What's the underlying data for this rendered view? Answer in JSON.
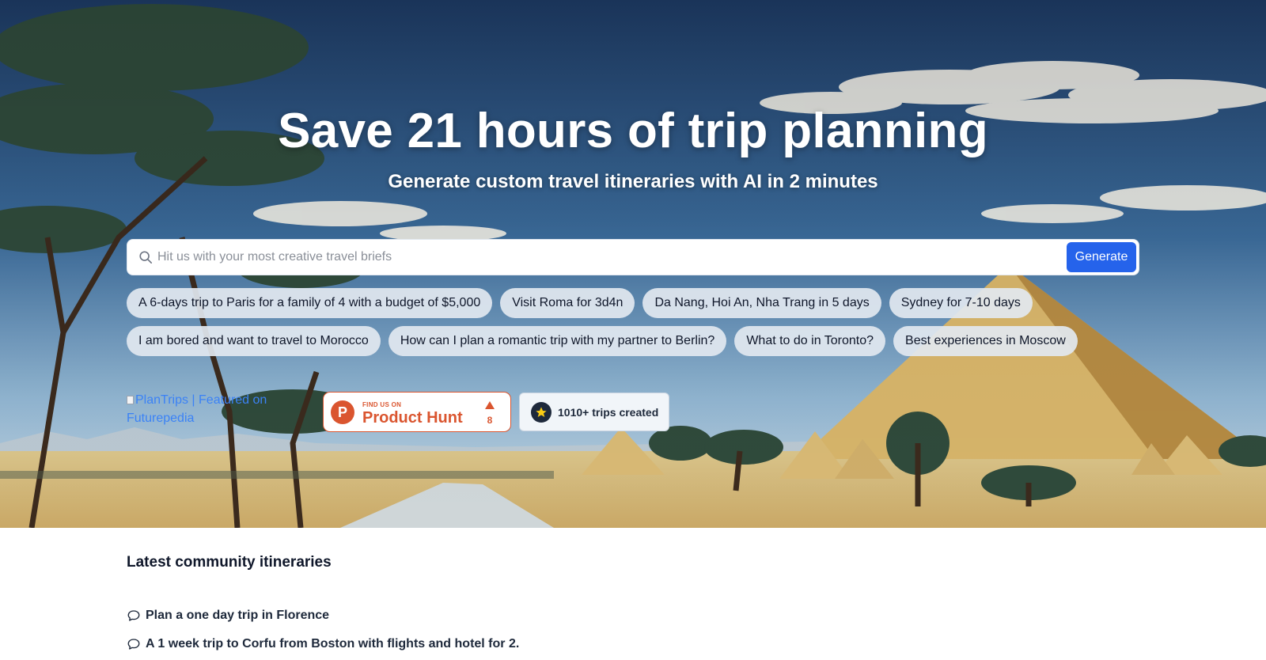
{
  "hero": {
    "headline": "Save 21 hours of trip planning",
    "subheadline": "Generate custom travel itineraries with AI in 2 minutes",
    "background": "savanna-with-pyramids-illustration"
  },
  "search": {
    "placeholder": "Hit us with your most creative travel briefs",
    "value": "",
    "icon": "search-icon",
    "button_label": "Generate"
  },
  "suggestions": [
    "A 6-days trip to Paris for a family of 4 with a budget of $5,000",
    "Visit Roma for 3d4n",
    "Da Nang, Hoi An, Nha Trang in 5 days",
    "Sydney for 7-10 days",
    "I am bored and want to travel to Morocco",
    "How can I plan a romantic trip with my partner to Berlin?",
    "What to do in Toronto?",
    "Best experiences in Moscow"
  ],
  "badges": {
    "futurepedia_alt": "PlanTrips | Featured on Futurepedia",
    "product_hunt": {
      "small": "FIND US ON",
      "big": "Product Hunt",
      "letter": "P",
      "count": "8"
    },
    "trips_created": "1010+ trips created"
  },
  "community": {
    "title": "Latest community itineraries",
    "items": [
      "Plan a one day trip in Florence",
      "A 1 week trip to Corfu from Boston with flights and hotel for 2."
    ]
  },
  "colors": {
    "accent": "#2563eb",
    "product_hunt": "#da552f",
    "text_dark": "#0f172a"
  }
}
